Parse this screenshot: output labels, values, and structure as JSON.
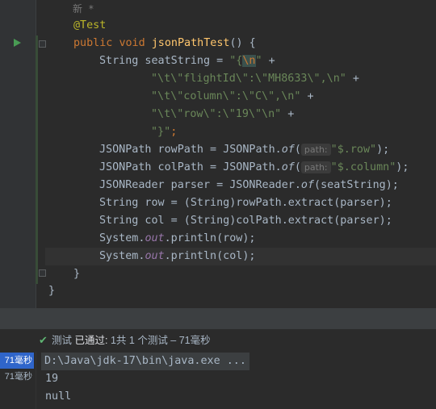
{
  "editor": {
    "hint_new": "新 *",
    "annotation": "@Test",
    "method_kw1": "public",
    "method_kw2": "void",
    "method_name": "jsonPathTest",
    "method_tail": "() {",
    "l_seat_type": "String seatString = ",
    "l_seat_str1": "\"{",
    "l_seat_esc1": "\\n",
    "l_seat_str1b": "\"",
    "l_seat_op1": " +",
    "l_fid": "\"\\t\\\"flightId\\\":\\\"MH8633\\\",\\n\"",
    "l_col": "\"\\t\\\"column\\\":\\\"C\\\",\\n\"",
    "l_row": "\"\\t\\\"row\\\":\\\"19\\\"\\n\"",
    "plus": " +",
    "l_close_str": "\"}\"",
    "semi": ";",
    "rowpath_a": "JSONPath rowPath = JSONPath.",
    "of": "of",
    "paren_open": "(",
    "path_hint": "path:",
    "rowpath_str": "\"$.row\"",
    "paren_close": ");",
    "colpath_a": "JSONPath colPath = JSONPath.",
    "colpath_str": "\"$.column\"",
    "reader_a": "JSONReader parser = JSONReader.",
    "reader_b": "(seatString);",
    "row_line_a": "String row = (String)rowPath.extract(parser);",
    "col_line_a": "String col = (String)colPath.extract(parser);",
    "sys": "System.",
    "out": "out",
    "println_row": ".println(row);",
    "println_col": ".println(col);",
    "close_method": "}",
    "close_class": "}"
  },
  "run_panel": {
    "status_prefix": "测试",
    "status_passed": "已通过:",
    "status_rest": "1共 1 个测试 – 71毫秒",
    "tree_items": [
      "71毫秒",
      "71毫秒"
    ],
    "cmd_line": "D:\\Java\\jdk-17\\bin\\java.exe ...",
    "out_line1": "19",
    "out_line2": "null"
  },
  "colors": {
    "keyword": "#cc7832",
    "string": "#6a8759",
    "method": "#ffc66d",
    "annotation": "#bbb529",
    "field": "#9876aa",
    "pass": "#5fb573",
    "selection": "#2f65ca"
  }
}
